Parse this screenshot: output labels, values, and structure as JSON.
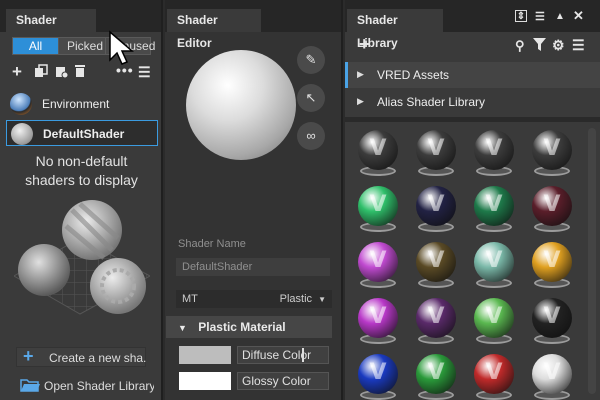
{
  "lister": {
    "tab": "Shader Lister",
    "filters": [
      "All",
      "Picked",
      "Unused"
    ],
    "items": [
      {
        "label": "Environment"
      },
      {
        "label": "DefaultShader"
      }
    ],
    "empty_message": [
      "No non-default",
      "shaders to display"
    ],
    "create_button": "Create a new sha...",
    "open_library_button": "Open Shader Library"
  },
  "editor": {
    "tab": "Shader Editor",
    "shader_name_label": "Shader Name",
    "shader_name_value": "DefaultShader",
    "mt_label": "MT",
    "mt_type": "Plastic",
    "section": "Plastic Material",
    "diffuse_label": "Diffuse Color",
    "glossy_label": "Glossy Color",
    "diffuse_color": "#bdbdbd",
    "glossy_color": "#ffffff"
  },
  "library": {
    "tab": "Shader Library",
    "rows": [
      {
        "label": "VRED Assets",
        "selected": true
      },
      {
        "label": "Alias Shader Library",
        "selected": false
      }
    ],
    "ball_colors": [
      [
        "#3c3c3c",
        "#3c3c3c",
        "#3c3c3c",
        "#3c3c3c"
      ],
      [
        "#2fbf6a",
        "#222244",
        "#1e7a4a",
        "#5a1e2a"
      ],
      [
        "#c04ad0",
        "#5a4a25",
        "#7ab8a8",
        "#e0a020"
      ],
      [
        "#b838c8",
        "#5a2a6a",
        "#5ab850",
        "#222222"
      ],
      [
        "#1a3ac0",
        "#2a9a3a",
        "#c02a2a",
        "#dcdcdc"
      ]
    ]
  }
}
